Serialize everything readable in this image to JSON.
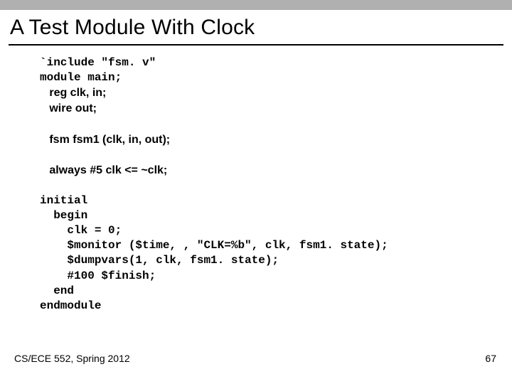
{
  "title": "A Test Module With Clock",
  "code": {
    "l1": "`include \"fsm. v\"",
    "l2": "module main;",
    "l3_s": "   reg clk, in;",
    "l4_s": "   wire out;",
    "blank1": " ",
    "l5_s": "   fsm fsm1 (clk, in, out);",
    "blank2": " ",
    "l6_s": "   always #5 clk <= ~clk;",
    "blank3": " ",
    "l7": "initial",
    "l8": "  begin",
    "l9": "    clk = 0;",
    "l10": "    $monitor ($time, , \"CLK=%b\", clk, fsm1. state);",
    "l11": "    $dumpvars(1, clk, fsm1. state);",
    "l12": "    #100 $finish;",
    "l13": "  end",
    "l14": "endmodule"
  },
  "footer": {
    "left": "CS/ECE 552, Spring 2012",
    "right": "67"
  }
}
